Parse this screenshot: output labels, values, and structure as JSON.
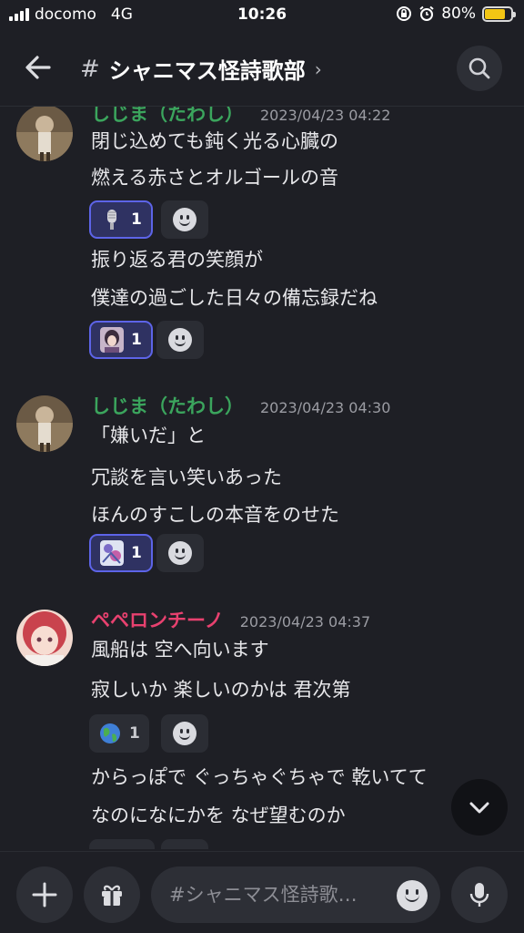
{
  "status": {
    "carrier": "docomo",
    "network": "4G",
    "time": "10:26",
    "battery": "80%",
    "battery_level": 0.8
  },
  "header": {
    "hash": "#",
    "channel": "シャニマス怪詩歌部",
    "chevron": "›"
  },
  "messages": [
    {
      "author": "しじま（たわし）",
      "author_color": "#3ba55d",
      "timestamp": "2023/04/23 04:22",
      "lines": [
        "閉じ込めても鈍く光る心臓の",
        "燃える赤さとオルゴールの音",
        "振り返る君の笑顔が",
        "僕達の過ごした日々の備忘録だね"
      ],
      "reactions": [
        {
          "emoji": "microphone",
          "count": "1",
          "active": true
        },
        {
          "emoji": "girl-portrait",
          "count": "1",
          "active": true
        }
      ]
    },
    {
      "author": "しじま（たわし）",
      "author_color": "#3ba55d",
      "timestamp": "2023/04/23 04:30",
      "lines": [
        "「嫌いだ」と",
        "冗談を言い笑いあった",
        "ほんのすこしの本音をのせた"
      ],
      "reactions": [
        {
          "emoji": "character-art",
          "count": "1",
          "active": true
        }
      ]
    },
    {
      "author": "ペペロンチーノ",
      "author_color": "#e8416f",
      "timestamp": "2023/04/23 04:37",
      "lines": [
        "風船は 空へ向います",
        "寂しいか 楽しいのかは 君次第",
        "からっぽで ぐっちゃぐちゃで 乾いてて",
        "なのになにかを なぜ望むのか"
      ],
      "reactions": [
        {
          "emoji": "globe",
          "count": "1",
          "active": false
        }
      ]
    }
  ],
  "input": {
    "placeholder": "#シャニマス怪詩歌…"
  }
}
